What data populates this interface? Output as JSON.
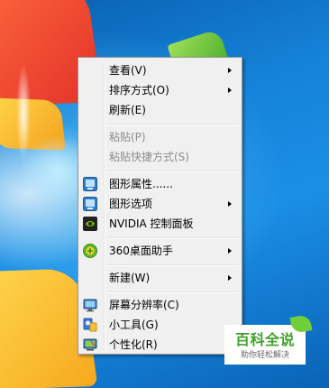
{
  "menu": {
    "items": [
      {
        "label": "查看(V)",
        "submenu": true
      },
      {
        "label": "排序方式(O)",
        "submenu": true
      },
      {
        "label": "刷新(E)"
      },
      {
        "label": "粘贴(P)",
        "disabled": true
      },
      {
        "label": "粘贴快捷方式(S)",
        "disabled": true
      },
      {
        "label": "图形属性......",
        "icon": "intel-graphics-icon"
      },
      {
        "label": "图形选项",
        "icon": "intel-graphics-options-icon",
        "submenu": true
      },
      {
        "label": "NVIDIA 控制面板",
        "icon": "nvidia-icon"
      },
      {
        "label": "360桌面助手",
        "icon": "360-icon",
        "submenu": true
      },
      {
        "label": "新建(W)",
        "submenu": true
      },
      {
        "label": "屏幕分辨率(C)",
        "icon": "display-icon"
      },
      {
        "label": "小工具(G)",
        "icon": "gadgets-icon"
      },
      {
        "label": "个性化(R)",
        "icon": "personalize-icon"
      }
    ]
  },
  "watermark": {
    "title": "百科全说",
    "subtitle": "助你轻松解决"
  },
  "colors": {
    "menu_bg": "#f0f0f0",
    "disabled_text": "#8d8d8d",
    "watermark_green": "#3fa12a"
  }
}
